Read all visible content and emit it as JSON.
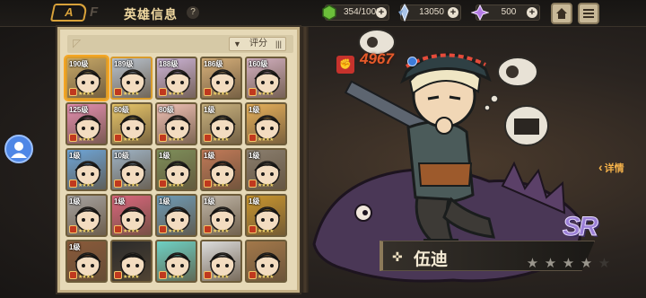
{
  "header": {
    "title": "英雄信息",
    "back_label": "A",
    "logo_text": "F",
    "help_symbol": "?"
  },
  "resources": [
    {
      "name": "stamina",
      "icon": "green-crystal-icon",
      "value": "354/1000"
    },
    {
      "name": "silver",
      "icon": "silver-crystal-icon",
      "value": "13050"
    },
    {
      "name": "gems",
      "icon": "purple-gem-icon",
      "value": "500"
    }
  ],
  "top_buttons": {
    "home_icon": "home-icon",
    "menu_icon": "menu-icon"
  },
  "panel": {
    "filter_label": "评分",
    "filter_icon": "funnel-icon",
    "sort_icon": "sort-icon"
  },
  "heroes": [
    {
      "level": "190级",
      "gold": true,
      "selected": true,
      "color": "#c7a867"
    },
    {
      "level": "189级",
      "gold": true,
      "color": "#b9c3cf"
    },
    {
      "level": "188级",
      "gold": false,
      "color": "#cdb4d8"
    },
    {
      "level": "186级",
      "gold": false,
      "color": "#d7b07a"
    },
    {
      "level": "160级",
      "gold": false,
      "color": "#d3b0c1"
    },
    {
      "level": "125级",
      "gold": false,
      "color": "#e58fb2"
    },
    {
      "level": "80级",
      "gold": false,
      "color": "#e9c76a"
    },
    {
      "level": "80级",
      "gold": false,
      "color": "#f0c1b6"
    },
    {
      "level": "1级",
      "gold": false,
      "color": "#c9b27e"
    },
    {
      "level": "1级",
      "gold": false,
      "color": "#e6b05b"
    },
    {
      "level": "1级",
      "gold": false,
      "color": "#6ea6d9"
    },
    {
      "level": "10级",
      "gold": false,
      "color": "#9fb4c6"
    },
    {
      "level": "1级",
      "gold": false,
      "color": "#7e8f5a"
    },
    {
      "level": "1级",
      "gold": false,
      "color": "#c27a58"
    },
    {
      "level": "1级",
      "gold": false,
      "color": "#8a7e6e"
    },
    {
      "level": "1级",
      "gold": false,
      "color": "#a7a3a0"
    },
    {
      "level": "1级",
      "gold": false,
      "color": "#d9667d"
    },
    {
      "level": "1级",
      "gold": false,
      "color": "#6f9bb6"
    },
    {
      "level": "1级",
      "gold": false,
      "color": "#bfb5a6"
    },
    {
      "level": "1级",
      "gold": false,
      "color": "#c9962f"
    },
    {
      "level": "1级",
      "gold": false,
      "color": "#8a5a3a"
    },
    {
      "level": "",
      "gold": false,
      "color": "#2b2b2b"
    },
    {
      "level": "",
      "gold": false,
      "color": "#6ed1c4"
    },
    {
      "level": "",
      "gold": false,
      "color": "#dcdcdc"
    },
    {
      "level": "",
      "gold": false,
      "color": "#a3784a"
    }
  ],
  "hero_showcase": {
    "power": "4967",
    "power_icon": "fist-icon",
    "name": "伍迪",
    "class_icon": "crosshair-icon",
    "rarity": "SR",
    "detail_label": "详情",
    "stars_total": 5,
    "stars_lit": 4
  },
  "colors": {
    "accent": "#d9a23a",
    "panel_bg": "#e6d9b7",
    "power": "#e65a2a",
    "rarity": "#9b7fd6"
  }
}
